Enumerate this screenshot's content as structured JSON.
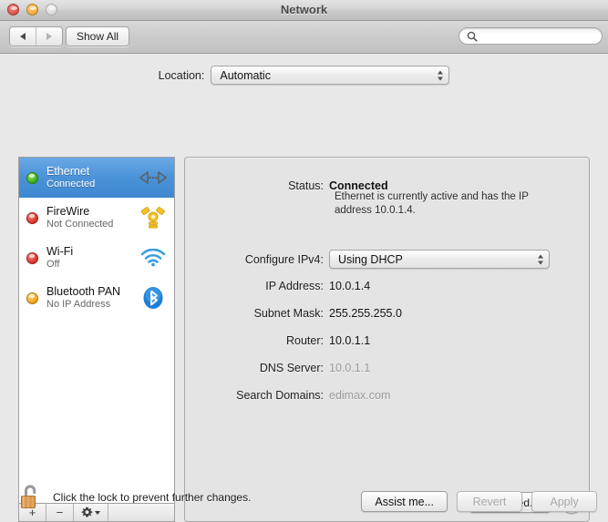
{
  "window": {
    "title": "Network",
    "traffic_lights": [
      "close-red",
      "minimize-amber",
      "zoom-gray-disabled"
    ]
  },
  "toolbar": {
    "back_icon": "triangle-left-icon",
    "forward_icon": "triangle-right-icon",
    "show_all_label": "Show All",
    "search": {
      "value": "",
      "placeholder": "",
      "icon": "search-icon"
    }
  },
  "location": {
    "label": "Location:",
    "selected": "Automatic"
  },
  "sidebar": {
    "services": [
      {
        "name": "Ethernet",
        "status": "Connected",
        "dot": "green",
        "icon": "ethernet-icon",
        "selected": true
      },
      {
        "name": "FireWire",
        "status": "Not Connected",
        "dot": "red",
        "icon": "firewire-icon",
        "selected": false
      },
      {
        "name": "Wi-Fi",
        "status": "Off",
        "dot": "red",
        "icon": "wifi-icon",
        "selected": false
      },
      {
        "name": "Bluetooth PAN",
        "status": "No IP Address",
        "dot": "amber",
        "icon": "bluetooth-icon",
        "selected": false
      }
    ],
    "toolbar": {
      "add_label": "+",
      "remove_label": "−",
      "action_icon": "gear-icon"
    }
  },
  "detail": {
    "status_label": "Status:",
    "status_value": "Connected",
    "status_description": "Ethernet is currently active and has the IP address 10.0.1.4.",
    "configure_label": "Configure IPv4:",
    "configure_value": "Using DHCP",
    "fields": [
      {
        "label": "IP Address:",
        "value": "10.0.1.4",
        "dim": false
      },
      {
        "label": "Subnet Mask:",
        "value": "255.255.255.0",
        "dim": false
      },
      {
        "label": "Router:",
        "value": "10.0.1.1",
        "dim": false
      },
      {
        "label": "DNS Server:",
        "value": "10.0.1.1",
        "dim": true
      },
      {
        "label": "Search Domains:",
        "value": "edimax.com",
        "dim": true
      }
    ],
    "advanced_label": "Advanced...",
    "help_label": "?"
  },
  "footer": {
    "lock_icon": "unlocked-padlock-icon",
    "lock_text": "Click the lock to prevent further changes.",
    "assist_label": "Assist me...",
    "revert_label": "Revert",
    "apply_label": "Apply"
  },
  "colors": {
    "selection_blue": "#4a92d8",
    "status_green": "#3fb321",
    "status_red": "#d9372c",
    "status_amber": "#f0a520",
    "window_bg": "#e8e8e8"
  }
}
